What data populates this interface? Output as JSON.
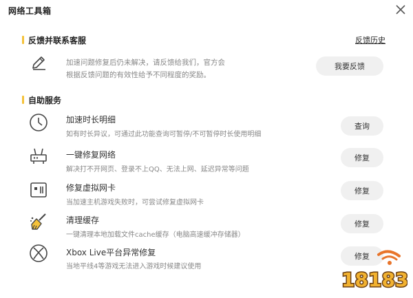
{
  "window": {
    "title": "网络工具箱"
  },
  "feedback_section": {
    "heading": "反馈并联系客服",
    "history_link": "反馈历史",
    "line1": "加速问题修复后仍未解决，请反馈给我们，官方会",
    "line2": "根据反馈问题的有效性给予不同程度的奖励。",
    "button": "我要反馈"
  },
  "self_service": {
    "heading": "自助服务",
    "items": [
      {
        "title": "加速时长明细",
        "desc": "如有时长异议，可通过此功能查询可暂停/不可暂停时长使用明细",
        "button": "查询",
        "icon": "clock-icon"
      },
      {
        "title": "一键修复网络",
        "desc": "解决打不开网页、登录不上QQ、无法上网、延迟异常等问题",
        "button": "修复",
        "icon": "router-icon"
      },
      {
        "title": "修复虚拟网卡",
        "desc": "当加速主机游戏失败时，可尝试修复虚拟网卡",
        "button": "修复",
        "icon": "network-card-icon"
      },
      {
        "title": "清理缓存",
        "desc": "一键清理本地加载文件cache缓存（电脑高速缓冲存储器）",
        "button": "修复",
        "icon": "broom-icon"
      },
      {
        "title": "Xbox Live平台异常修复",
        "desc": "当地平线4等游戏无法进入游戏时候建议使用",
        "button": "修复",
        "icon": "xbox-icon"
      }
    ]
  },
  "watermark": {
    "text": "18183"
  },
  "colors": {
    "accent": "#f5c23a",
    "button_bg": "#f0f0f0",
    "desc_text": "#888888"
  }
}
